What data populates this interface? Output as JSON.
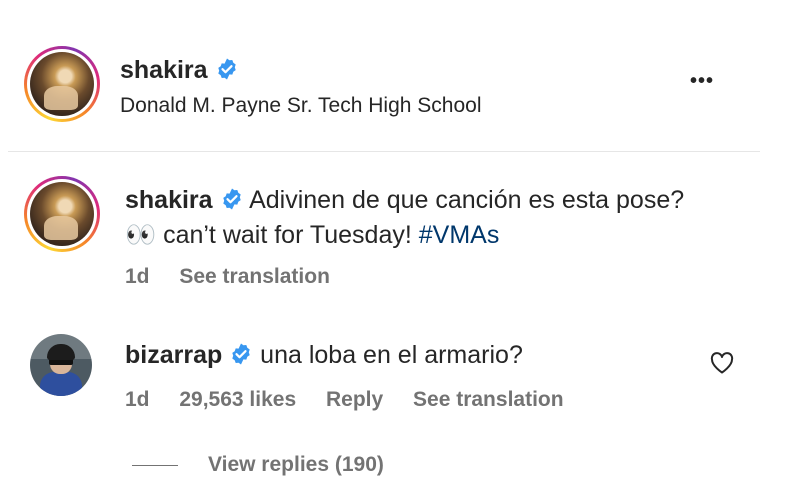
{
  "header": {
    "username": "shakira",
    "location": "Donald M. Payne Sr. Tech High School",
    "more_label": "•••"
  },
  "caption": {
    "username": "shakira",
    "text": "Adivinen de que canción es esta pose? 👀 can’t wait for Tuesday!",
    "hashtag": "#VMAs",
    "time": "1d",
    "see_translation": "See translation"
  },
  "comment": {
    "username": "bizarrap",
    "text": "una loba en el armario?",
    "time": "1d",
    "likes": "29,563 likes",
    "reply": "Reply",
    "see_translation": "See translation",
    "view_replies": "View replies (190)"
  },
  "colors": {
    "verified": "#3897f0",
    "hashtag": "#00376b",
    "muted": "#737373",
    "text": "#262626"
  },
  "icons": [
    "verified-badge-icon",
    "more-options-icon",
    "heart-icon"
  ]
}
